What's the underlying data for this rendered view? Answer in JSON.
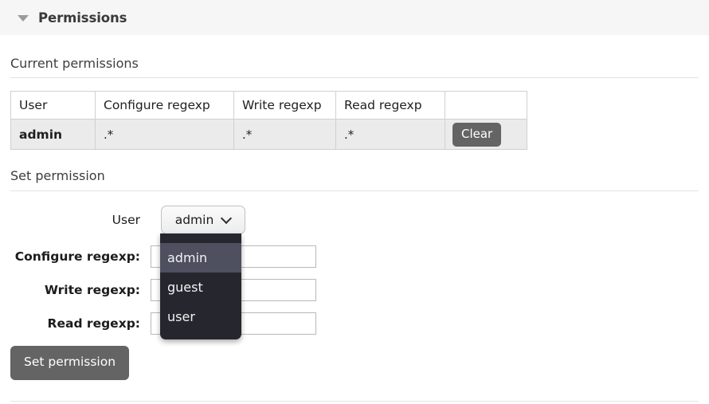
{
  "panel": {
    "title": "Permissions",
    "collapse_icon": "triangle-down-icon"
  },
  "current_permissions": {
    "heading": "Current permissions",
    "columns": [
      "User",
      "Configure regexp",
      "Write regexp",
      "Read regexp",
      ""
    ],
    "rows": [
      {
        "user": "admin",
        "configure": ".*",
        "write": ".*",
        "read": ".*",
        "action_label": "Clear"
      }
    ]
  },
  "set_permission": {
    "heading": "Set permission",
    "user_label": "User",
    "user_value": "admin",
    "user_options": [
      "admin",
      "guest",
      "user"
    ],
    "dropdown_open": true,
    "dropdown_selected": "admin",
    "chevron_icon": "chevron-down-icon",
    "fields": [
      {
        "label": "Configure regexp:",
        "value": "",
        "placeholder": ""
      },
      {
        "label": "Write regexp:",
        "value": "",
        "placeholder": ""
      },
      {
        "label": "Read regexp:",
        "value": "",
        "placeholder": ""
      }
    ],
    "submit_label": "Set permission"
  },
  "colors": {
    "header_bg": "#f6f6f6",
    "button_bg": "#646464",
    "row_bg": "#ebebeb",
    "dropdown_bg": "#26262e",
    "dropdown_highlight": "#4e5060"
  }
}
